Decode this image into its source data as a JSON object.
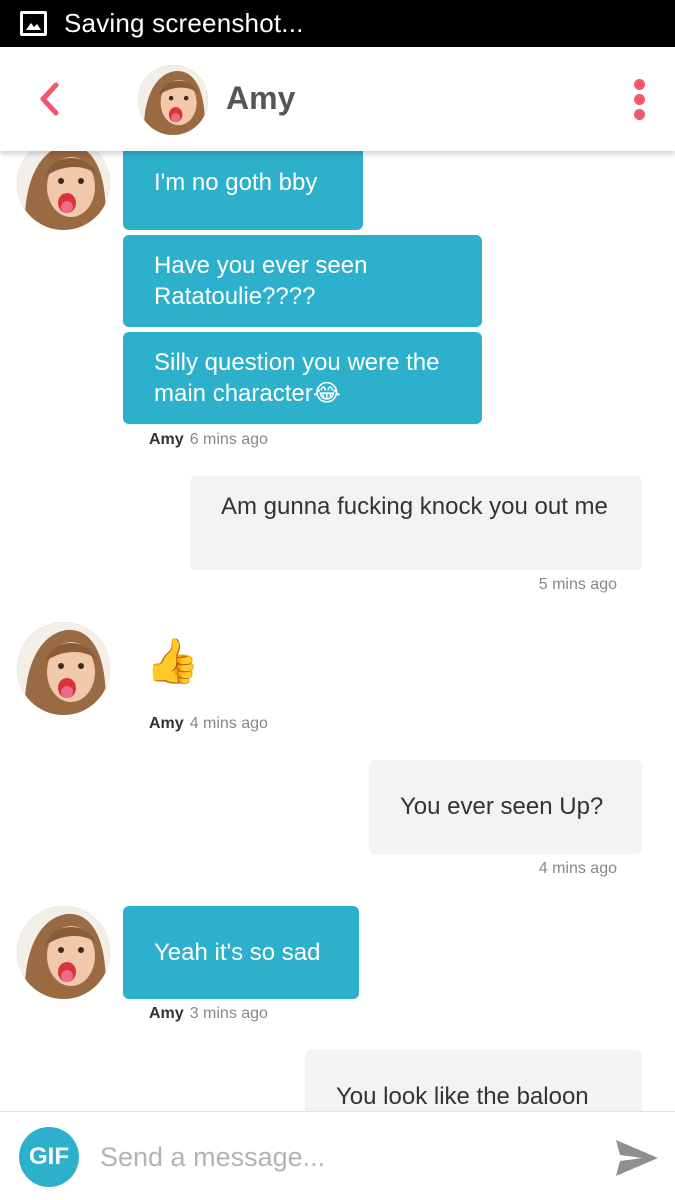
{
  "status_bar": {
    "text": "Saving screenshot..."
  },
  "header": {
    "name": "Amy"
  },
  "messages": [
    {
      "from": "Amy",
      "text": "I'm no goth bby"
    },
    {
      "from": "Amy",
      "text": "Have you ever seen Ratatoulie????"
    },
    {
      "from": "Amy",
      "text": "Silly question you were the main character😂"
    },
    {
      "from": "me",
      "text": "Am gunna fucking knock you out me"
    },
    {
      "from": "Amy",
      "text": "👍"
    },
    {
      "from": "me",
      "text": "You ever seen Up?"
    },
    {
      "from": "Amy",
      "text": "Yeah it's so sad"
    },
    {
      "from": "me",
      "text": "You look like the baloon"
    }
  ],
  "meta": [
    {
      "sender": "Amy",
      "time": "6 mins ago"
    },
    {
      "time": "5 mins ago"
    },
    {
      "sender": "Amy",
      "time": "4 mins ago"
    },
    {
      "time": "4 mins ago"
    },
    {
      "sender": "Amy",
      "time": "3 mins ago"
    }
  ],
  "composer": {
    "gif_label": "GIF",
    "placeholder": "Send a message..."
  },
  "colors": {
    "accent": "#2db0cc",
    "brand": "#f0596b",
    "outgoing_bubble": "#f3f3f3"
  },
  "icons": {
    "back": "chevron-left-icon",
    "menu": "more-vertical-icon",
    "send": "send-icon",
    "status": "image-icon"
  }
}
